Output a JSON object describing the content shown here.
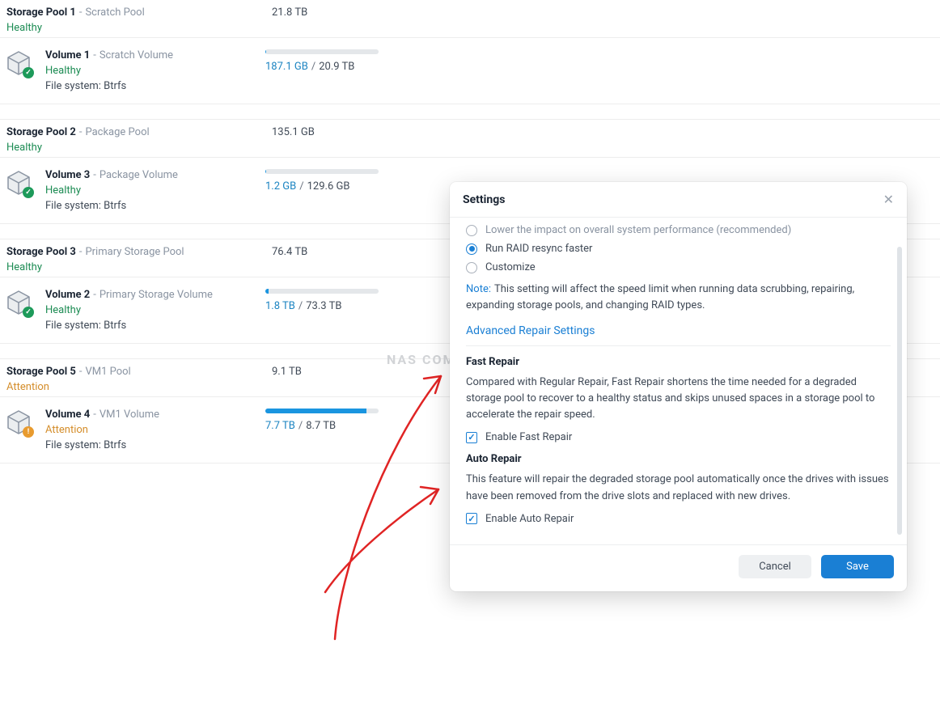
{
  "watermark": "NAS COMPARES",
  "pools": [
    {
      "name": "Storage Pool 1",
      "label": "Scratch Pool",
      "size": "21.8 TB",
      "status": "Healthy",
      "status_class": "healthy"
    },
    {
      "name": "Storage Pool 2",
      "label": "Package Pool",
      "size": "135.1 GB",
      "status": "Healthy",
      "status_class": "healthy"
    },
    {
      "name": "Storage Pool 3",
      "label": "Primary Storage Pool",
      "size": "76.4 TB",
      "status": "Healthy",
      "status_class": "healthy"
    },
    {
      "name": "Storage Pool 5",
      "label": "VM1 Pool",
      "size": "9.1 TB",
      "status": "Attention",
      "status_class": "attention"
    }
  ],
  "volumes": [
    {
      "name": "Volume 1",
      "label": "Scratch Volume",
      "status": "Healthy",
      "status_class": "healthy",
      "fs": "File system: Btrfs",
      "used": "187.1 GB",
      "total": "20.9 TB",
      "pct": 1,
      "badge": "ok"
    },
    {
      "name": "Volume 3",
      "label": "Package Volume",
      "status": "Healthy",
      "status_class": "healthy",
      "fs": "File system: Btrfs",
      "used": "1.2 GB",
      "total": "129.6 GB",
      "pct": 1,
      "badge": "ok"
    },
    {
      "name": "Volume 2",
      "label": "Primary Storage Volume",
      "status": "Healthy",
      "status_class": "healthy",
      "fs": "File system: Btrfs",
      "used": "1.8 TB",
      "total": "73.3 TB",
      "pct": 3,
      "badge": "ok"
    },
    {
      "name": "Volume 4",
      "label": "VM1 Volume",
      "status": "Attention",
      "status_class": "attention",
      "fs": "File system: Btrfs",
      "used": "7.7 TB",
      "total": "8.7 TB",
      "pct": 89,
      "badge": "warn"
    }
  ],
  "modal": {
    "title": "Settings",
    "radios": {
      "opt1": "Lower the impact on overall system performance (recommended)",
      "opt2": "Run RAID resync faster",
      "opt3": "Customize"
    },
    "note_label": "Note:",
    "note_text": "This setting will affect the speed limit when running data scrubbing, repairing, expanding storage pools, and changing RAID types.",
    "section": "Advanced Repair Settings",
    "fast_repair_head": "Fast Repair",
    "fast_repair_desc": "Compared with Regular Repair, Fast Repair shortens the time needed for a degraded storage pool to recover to a healthy status and skips unused spaces in a storage pool to accelerate the repair speed.",
    "fast_repair_check": "Enable Fast Repair",
    "auto_repair_head": "Auto Repair",
    "auto_repair_desc": "This feature will repair the degraded storage pool automatically once the drives with issues have been removed from the drive slots and replaced with new drives.",
    "auto_repair_check": "Enable Auto Repair",
    "cancel": "Cancel",
    "save": "Save"
  }
}
